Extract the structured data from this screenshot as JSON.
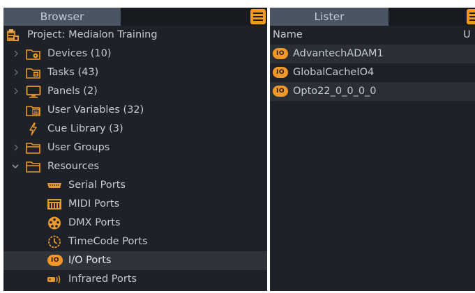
{
  "browser": {
    "tab_label": "Browser",
    "menu_icon": "menu-icon",
    "items": [
      {
        "label": "Project: Medialon Training",
        "icon": "project-icon",
        "expander": "none"
      },
      {
        "label": "Devices (10)",
        "icon": "devices-folder-icon",
        "expander": "collapsed"
      },
      {
        "label": "Tasks (43)",
        "icon": "tasks-folder-icon",
        "expander": "collapsed"
      },
      {
        "label": "Panels (2)",
        "icon": "monitor-icon",
        "expander": "collapsed"
      },
      {
        "label": "User Variables (32)",
        "icon": "variables-folder-icon",
        "expander": "none"
      },
      {
        "label": "Cue Library (3)",
        "icon": "lightning-icon",
        "expander": "none"
      },
      {
        "label": "User Groups",
        "icon": "folder-icon",
        "expander": "collapsed"
      },
      {
        "label": "Resources",
        "icon": "folder-icon",
        "expander": "expanded"
      },
      {
        "label": "Serial Ports",
        "icon": "serial-port-icon",
        "expander": "none"
      },
      {
        "label": "MIDI Ports",
        "icon": "midi-port-icon",
        "expander": "none"
      },
      {
        "label": "DMX Ports",
        "icon": "dmx-port-icon",
        "expander": "none"
      },
      {
        "label": "TimeCode Ports",
        "icon": "clock-icon",
        "expander": "none"
      },
      {
        "label": "I/O Ports",
        "icon": "io-port-icon",
        "expander": "none",
        "selected": true
      },
      {
        "label": "Infrared Ports",
        "icon": "infrared-icon",
        "expander": "none"
      }
    ]
  },
  "lister": {
    "tab_label": "Lister",
    "menu_icon": "menu-icon",
    "columns": {
      "name": "Name",
      "u": "U"
    },
    "io_badge_text": "IO",
    "rows": [
      {
        "name": "AdvantechADAM1"
      },
      {
        "name": "GlobalCacheIO4"
      },
      {
        "name": "Opto22_0_0_0_0"
      }
    ]
  },
  "colors": {
    "panel_bg": "#1e2228",
    "tab_bg": "#4a5462",
    "accent": "#f09a18",
    "text": "#c6ccd3",
    "selected_row": "#2f343b"
  }
}
